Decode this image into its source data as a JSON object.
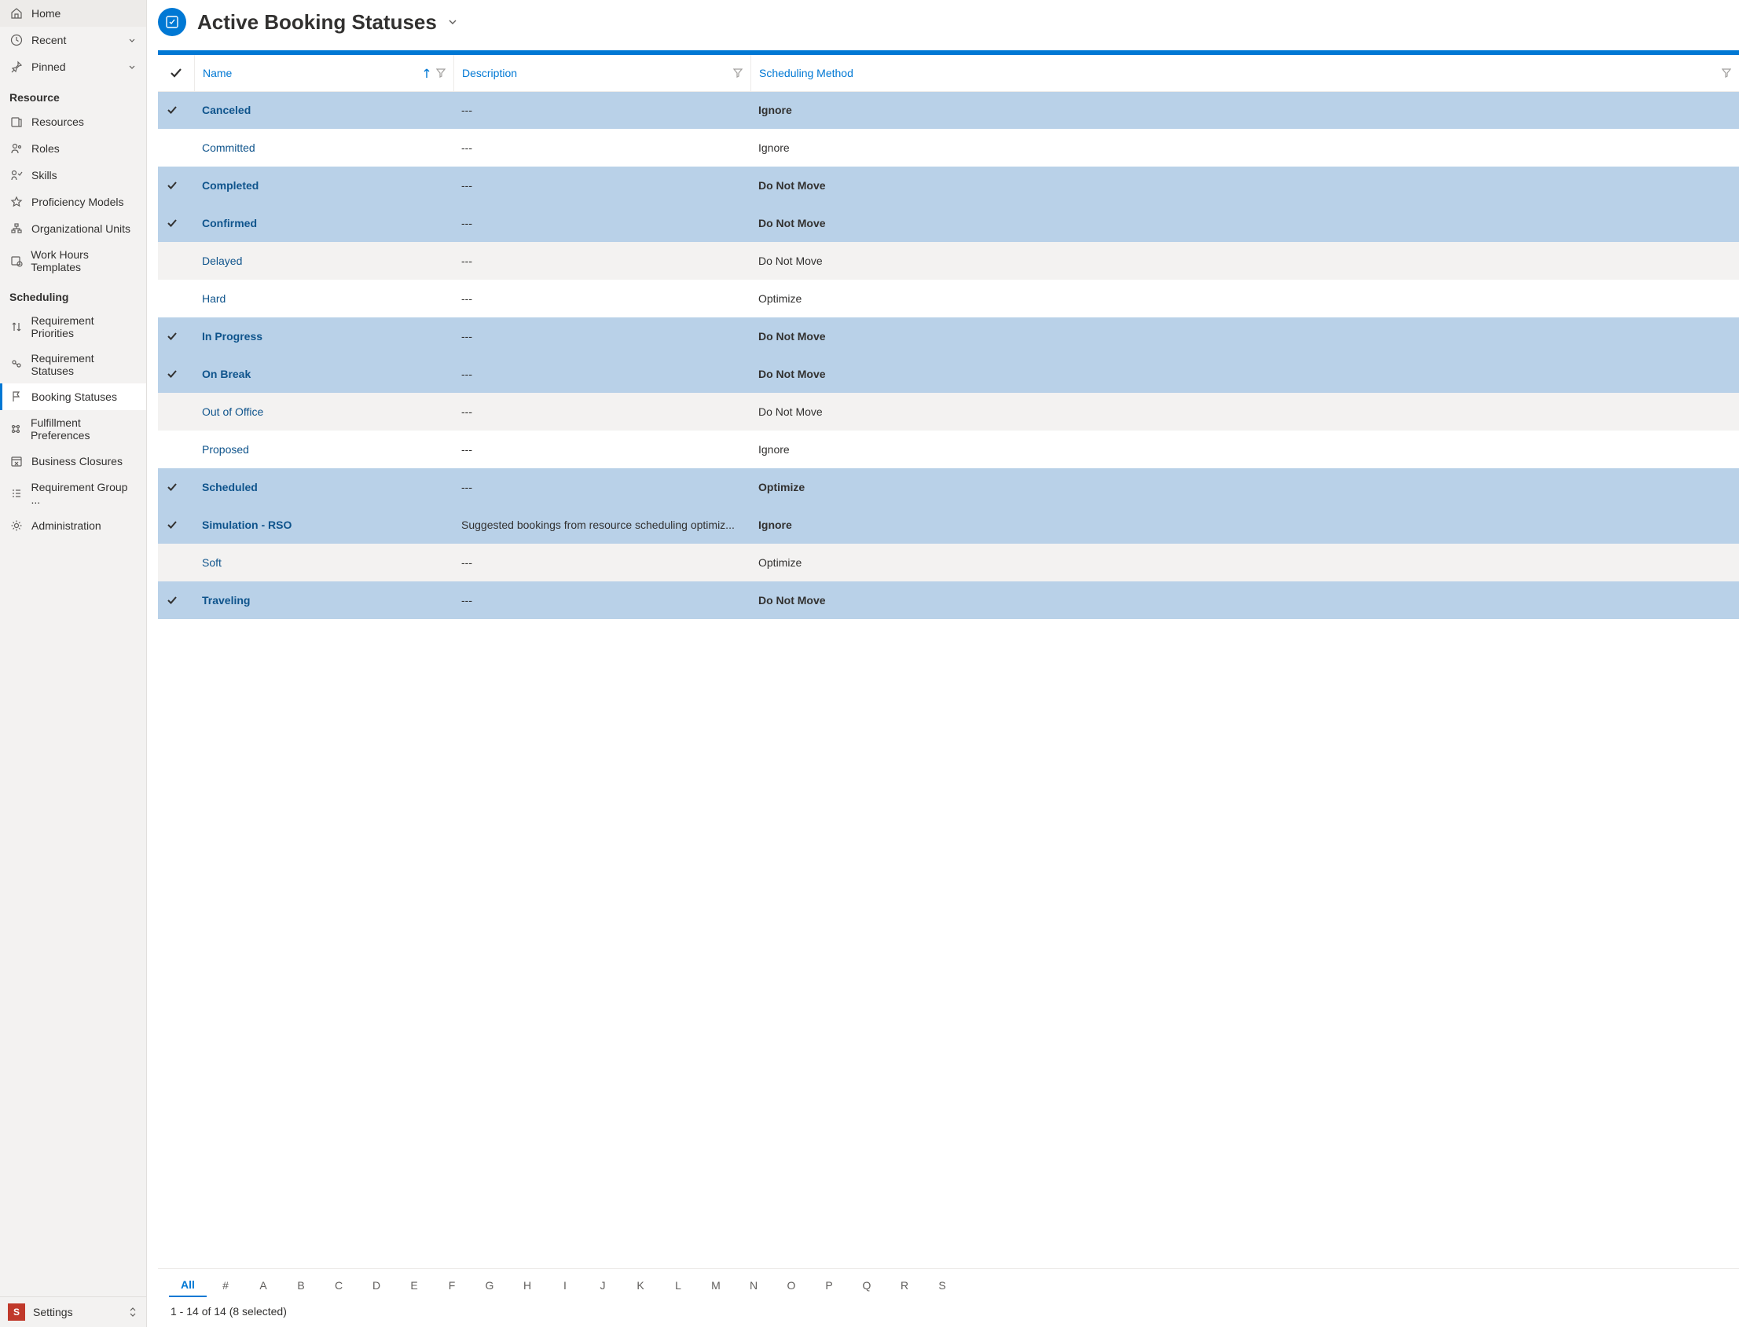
{
  "nav": {
    "home": "Home",
    "recent": "Recent",
    "pinned": "Pinned",
    "sections": {
      "resource": {
        "title": "Resource",
        "items": [
          "Resources",
          "Roles",
          "Skills",
          "Proficiency Models",
          "Organizational Units",
          "Work Hours Templates"
        ]
      },
      "scheduling": {
        "title": "Scheduling",
        "items": [
          "Requirement Priorities",
          "Requirement Statuses",
          "Booking Statuses",
          "Fulfillment Preferences",
          "Business Closures",
          "Requirement Group ...",
          "Administration"
        ]
      }
    }
  },
  "footer": {
    "badge": "S",
    "label": "Settings"
  },
  "header": {
    "title": "Active Booking Statuses"
  },
  "columns": {
    "name": "Name",
    "desc": "Description",
    "sched": "Scheduling Method"
  },
  "rows": [
    {
      "sel": true,
      "alt": false,
      "name": "Canceled",
      "desc": "---",
      "sched": "Ignore"
    },
    {
      "sel": false,
      "alt": false,
      "name": "Committed",
      "desc": "---",
      "sched": "Ignore"
    },
    {
      "sel": true,
      "alt": false,
      "name": "Completed",
      "desc": "---",
      "sched": "Do Not Move"
    },
    {
      "sel": true,
      "alt": false,
      "name": "Confirmed",
      "desc": "---",
      "sched": "Do Not Move"
    },
    {
      "sel": false,
      "alt": true,
      "name": "Delayed",
      "desc": "---",
      "sched": "Do Not Move"
    },
    {
      "sel": false,
      "alt": false,
      "name": "Hard",
      "desc": "---",
      "sched": "Optimize"
    },
    {
      "sel": true,
      "alt": false,
      "name": "In Progress",
      "desc": "---",
      "sched": "Do Not Move"
    },
    {
      "sel": true,
      "alt": false,
      "name": "On Break",
      "desc": "---",
      "sched": "Do Not Move"
    },
    {
      "sel": false,
      "alt": true,
      "name": "Out of Office",
      "desc": "---",
      "sched": "Do Not Move"
    },
    {
      "sel": false,
      "alt": false,
      "name": "Proposed",
      "desc": "---",
      "sched": "Ignore"
    },
    {
      "sel": true,
      "alt": false,
      "name": "Scheduled",
      "desc": "---",
      "sched": "Optimize"
    },
    {
      "sel": true,
      "alt": false,
      "name": "Simulation - RSO",
      "desc": "Suggested bookings from resource scheduling optimiz...",
      "sched": "Ignore"
    },
    {
      "sel": false,
      "alt": true,
      "name": "Soft",
      "desc": "---",
      "sched": "Optimize"
    },
    {
      "sel": true,
      "alt": false,
      "name": "Traveling",
      "desc": "---",
      "sched": "Do Not Move"
    }
  ],
  "jump": [
    "All",
    "#",
    "A",
    "B",
    "C",
    "D",
    "E",
    "F",
    "G",
    "H",
    "I",
    "J",
    "K",
    "L",
    "M",
    "N",
    "O",
    "P",
    "Q",
    "R",
    "S"
  ],
  "pager": "1 - 14 of 14 (8 selected)"
}
